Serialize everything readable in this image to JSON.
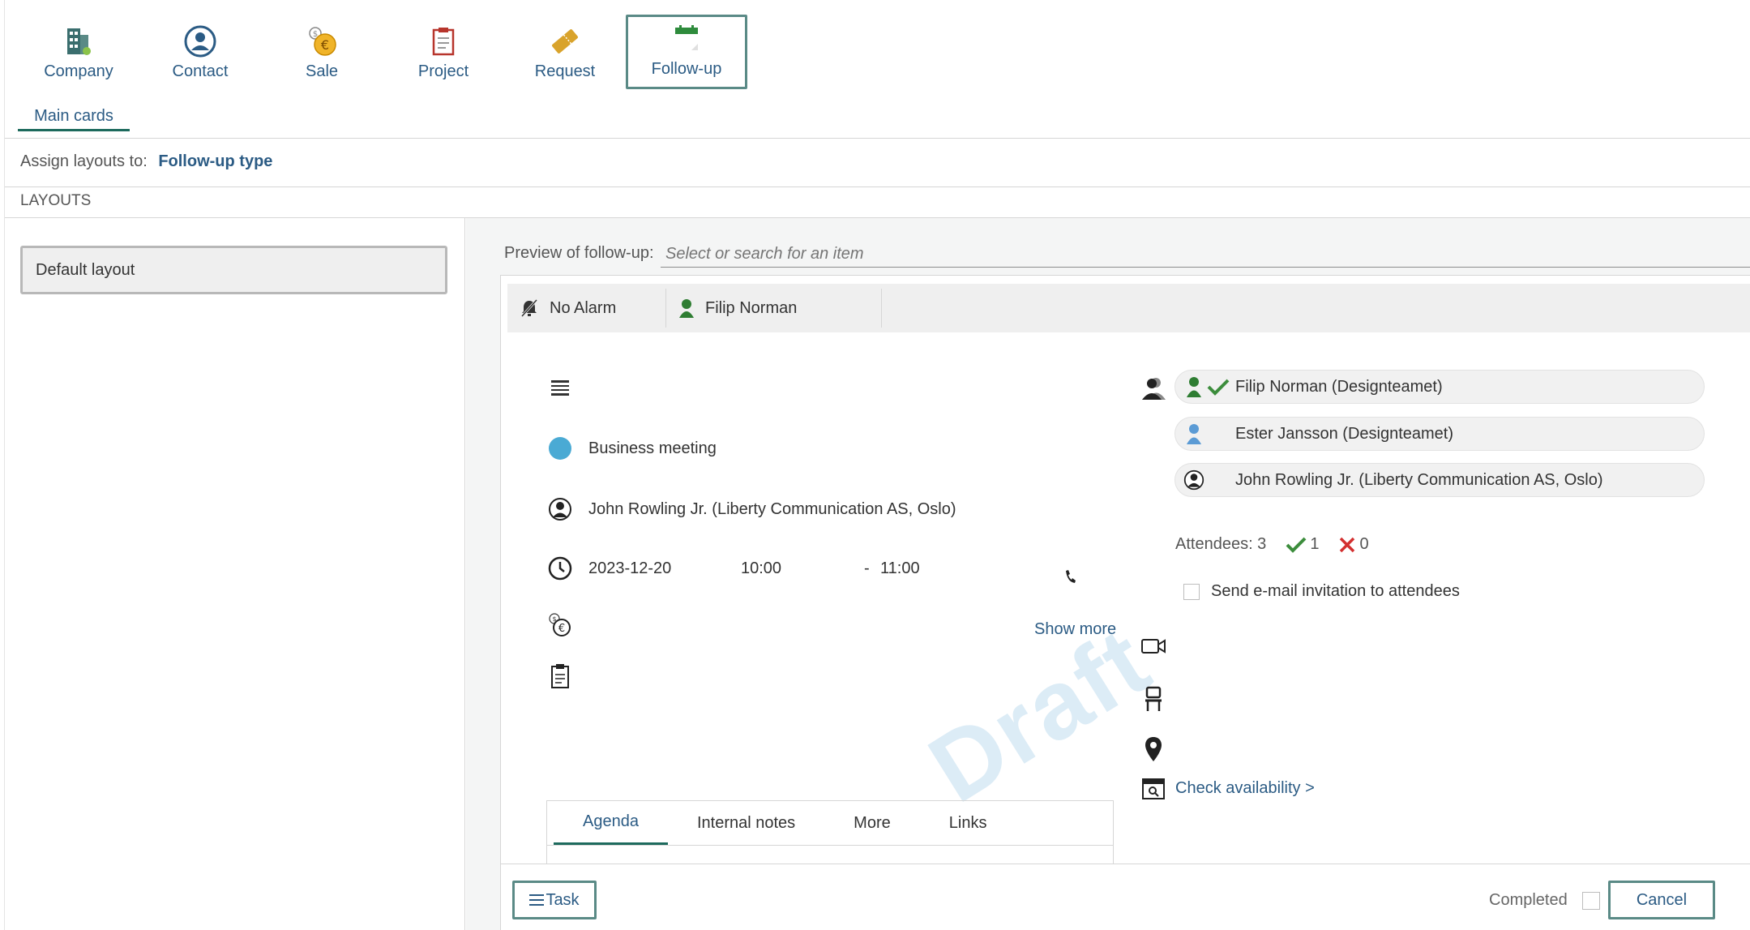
{
  "cardbar": {
    "items": [
      {
        "label": "Company",
        "icon": "company-icon"
      },
      {
        "label": "Contact",
        "icon": "contact-icon"
      },
      {
        "label": "Sale",
        "icon": "sale-icon"
      },
      {
        "label": "Project",
        "icon": "project-icon"
      },
      {
        "label": "Request",
        "icon": "request-icon"
      },
      {
        "label": "Follow-up",
        "icon": "follow-up-icon",
        "active": true
      }
    ]
  },
  "tabs": {
    "main_cards": "Main cards"
  },
  "assign": {
    "label": "Assign layouts to:",
    "value": "Follow-up type"
  },
  "layouts": {
    "heading": "LAYOUTS",
    "items": [
      "Default layout"
    ]
  },
  "preview": {
    "label": "Preview of follow-up:",
    "placeholder": "Select or search for an item"
  },
  "infobar": {
    "alarm": "No Alarm",
    "owner": "Filip Norman"
  },
  "fields": {
    "type": "Business meeting",
    "contact": "John Rowling Jr. (Liberty Communication AS, Oslo)",
    "date": "2023-12-20",
    "start_time": "10:00",
    "dash": "-",
    "end_time": "11:00",
    "show_more": "Show more"
  },
  "watermark": "Draft",
  "detail_tabs": [
    "Agenda",
    "Internal notes",
    "More",
    "Links"
  ],
  "participants": [
    {
      "name": "Filip Norman (Designteamet)",
      "color": "#2e7d32",
      "accepted": true
    },
    {
      "name": "Ester Jansson (Designteamet)",
      "color": "#5b9bd5",
      "accepted": false
    },
    {
      "name": "John Rowling Jr. (Liberty Communication AS, Oslo)",
      "color": "#222222",
      "accepted": false
    }
  ],
  "attendees": {
    "label": "Attendees: 3",
    "accepted": "1",
    "declined": "0"
  },
  "invite": {
    "label": "Send e-mail invitation to attendees"
  },
  "check_availability": "Check availability >",
  "bottom": {
    "task": "Task",
    "completed": "Completed",
    "cancel": "Cancel"
  },
  "colors": {
    "accent": "#1d6a5d",
    "link": "#2b5b84",
    "accept": "#3c8d3c",
    "decline": "#d32f2f",
    "meeting_dot": "#4aaad4"
  }
}
